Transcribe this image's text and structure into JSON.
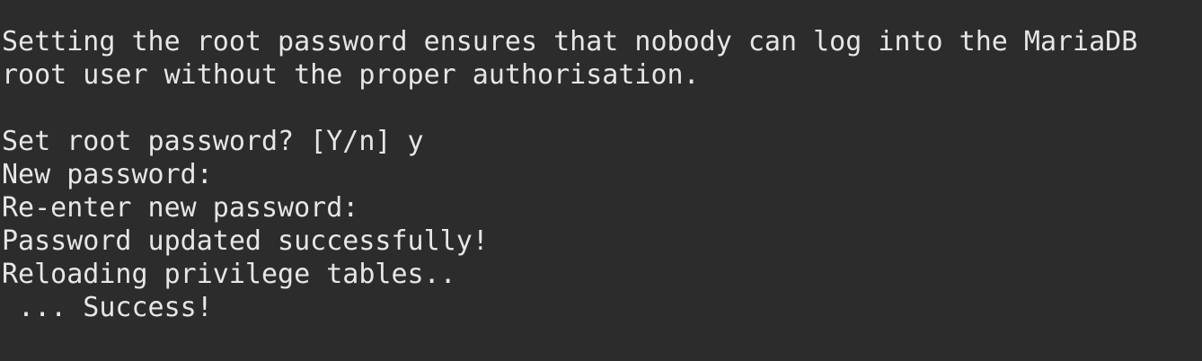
{
  "terminal": {
    "lines": [
      "Setting the root password ensures that nobody can log into the MariaDB",
      "root user without the proper authorisation.",
      "",
      "Set root password? [Y/n] y",
      "New password:",
      "Re-enter new password:",
      "Password updated successfully!",
      "Reloading privilege tables..",
      " ... Success!"
    ]
  }
}
